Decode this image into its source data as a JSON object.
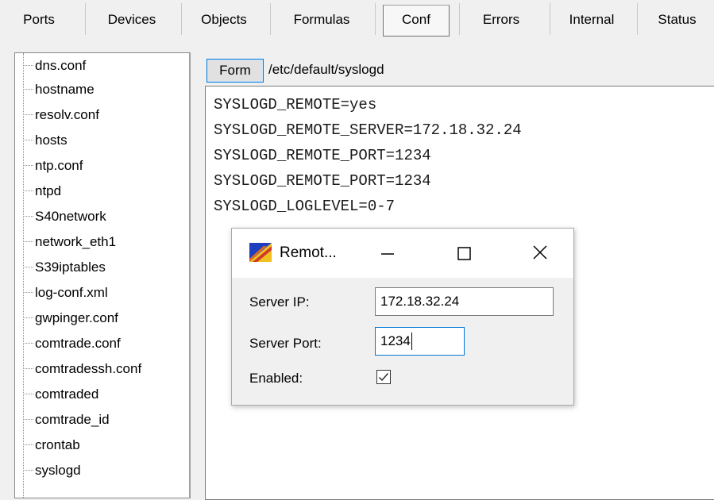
{
  "tabs": [
    {
      "label": "Ports",
      "active": false
    },
    {
      "label": "Devices",
      "active": false
    },
    {
      "label": "Objects",
      "active": false
    },
    {
      "label": "Formulas",
      "active": false
    },
    {
      "label": "Conf",
      "active": true
    },
    {
      "label": "Errors",
      "active": false
    },
    {
      "label": "Internal",
      "active": false
    },
    {
      "label": "Status",
      "active": false
    }
  ],
  "tree": {
    "items": [
      "dns.conf",
      "hostname",
      "resolv.conf",
      "hosts",
      "ntp.conf",
      "ntpd",
      "S40network",
      "network_eth1",
      "S39iptables",
      "log-conf.xml",
      "gwpinger.conf",
      "comtrade.conf",
      "comtradessh.conf",
      "comtraded",
      "comtrade_id",
      "crontab",
      "syslogd"
    ]
  },
  "content": {
    "form_button_label": "Form",
    "file_path": "/etc/default/syslogd",
    "lines": [
      "SYSLOGD_REMOTE=yes",
      "SYSLOGD_REMOTE_SERVER=172.18.32.24",
      "SYSLOGD_REMOTE_PORT=1234",
      "SYSLOGD_REMOTE_PORT=1234",
      "SYSLOGD_LOGLEVEL=0-7"
    ]
  },
  "dialog": {
    "title": "Remot...",
    "server_ip_label": "Server IP:",
    "server_ip_value": "172.18.32.24",
    "server_port_label": "Server Port:",
    "server_port_value": "1234",
    "enabled_label": "Enabled:",
    "enabled_checked": true,
    "icons": {
      "app": "app-logo-icon",
      "minimize": "minimize-icon",
      "maximize": "maximize-icon",
      "close": "close-icon"
    }
  },
  "colors": {
    "focus": "#0078d7",
    "background": "#f0f0f0",
    "panel": "#ffffff"
  }
}
